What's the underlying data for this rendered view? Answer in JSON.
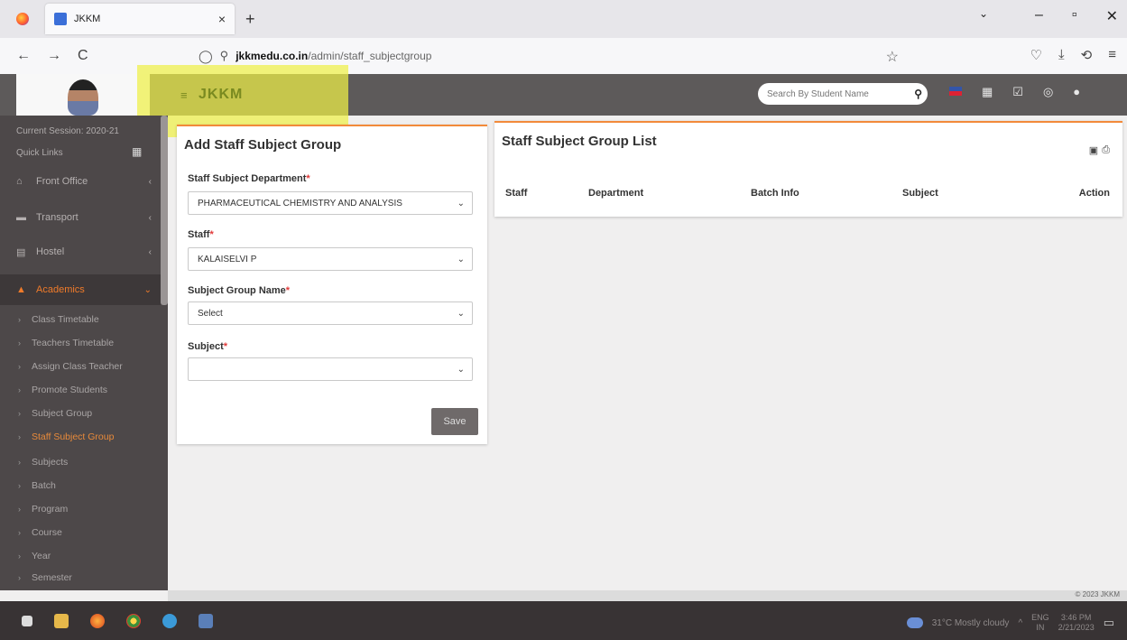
{
  "browser": {
    "tab_title": "JKKM",
    "tab_close": "×",
    "new_tab": "+",
    "url_domain": "jkkmedu.co.in",
    "url_path": "/admin/staff_subjectgroup",
    "back": "←",
    "forward": "→",
    "reload": "C",
    "bookmark_icon": "star-icon"
  },
  "header": {
    "brand": "JKKM",
    "menu_icon": "≡",
    "search_placeholder": "Search By Student Name"
  },
  "sidebar": {
    "session": "Current Session: 2020-21",
    "quick_links": "Quick Links",
    "items": [
      {
        "label": "Front Office",
        "icon": "building-icon"
      },
      {
        "label": "Transport",
        "icon": "bus-icon"
      },
      {
        "label": "Hostel",
        "icon": "hostel-icon"
      },
      {
        "label": "Academics",
        "icon": "graduation-cap-icon"
      }
    ],
    "sub_items": [
      "Class Timetable",
      "Teachers Timetable",
      "Assign Class Teacher",
      "Promote Students",
      "Subject Group",
      "Staff Subject Group",
      "Subjects",
      "Batch",
      "Program",
      "Course",
      "Year",
      "Semester"
    ],
    "active_sub": "Staff Subject Group"
  },
  "form": {
    "title": "Add Staff Subject Group",
    "dept_label": "Staff Subject Department",
    "dept_value": "PHARMACEUTICAL CHEMISTRY AND ANALYSIS",
    "staff_label": "Staff",
    "staff_value": "KALAISELVI P",
    "group_label": "Subject Group Name",
    "group_value": "Select",
    "subject_label": "Subject",
    "subject_value": "",
    "required_mark": "*",
    "save_label": "Save"
  },
  "list": {
    "title": "Staff Subject Group List",
    "columns": [
      "Staff",
      "Department",
      "Batch Info",
      "Subject",
      "Action"
    ]
  },
  "footer": {
    "copyright": "© 2023 JKKM"
  },
  "taskbar": {
    "weather": "31°C Mostly cloudy",
    "lang": "ENG",
    "region": "IN",
    "time": "3:46 PM",
    "date": "2/21/2023"
  },
  "colors": {
    "accent": "#f28a3a",
    "sidebar_bg": "#4d4849",
    "header_bg": "#5d5a5a",
    "highlight": "#eef046"
  }
}
